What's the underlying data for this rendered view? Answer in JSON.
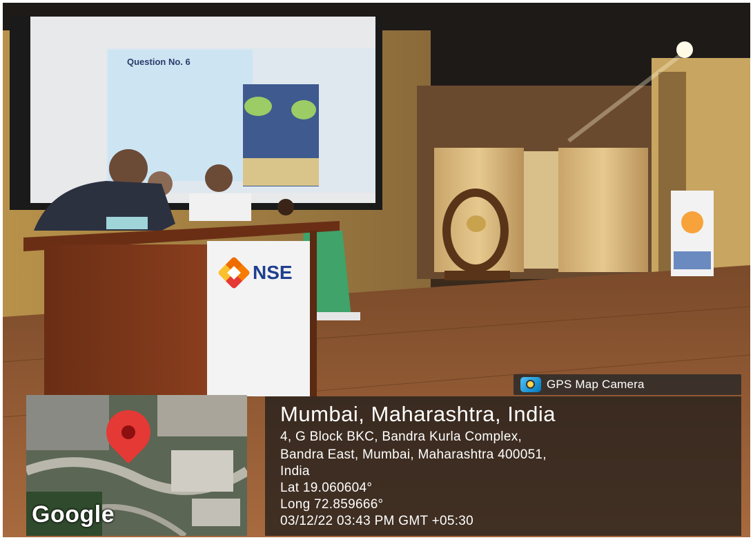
{
  "podium": {
    "logo_text": "NSE"
  },
  "screen": {
    "slide_title": "Question No. 6"
  },
  "gps_camera": {
    "app_label": "GPS Map Camera",
    "location_title": "Mumbai, Maharashtra, India",
    "address_line_1": "4, G Block BKC, Bandra Kurla Complex,",
    "address_line_2": "Bandra East, Mumbai, Maharashtra 400051,",
    "address_line_3": "India",
    "latitude": "Lat 19.060604°",
    "longitude": "Long 72.859666°",
    "timestamp": "03/12/22 03:43 PM GMT +05:30"
  },
  "map": {
    "attribution": "Google",
    "pin_icon": "location-pin-icon"
  },
  "colors": {
    "pin": "#e53935",
    "nse_orange": "#f57c00",
    "overlay": "#191919"
  }
}
